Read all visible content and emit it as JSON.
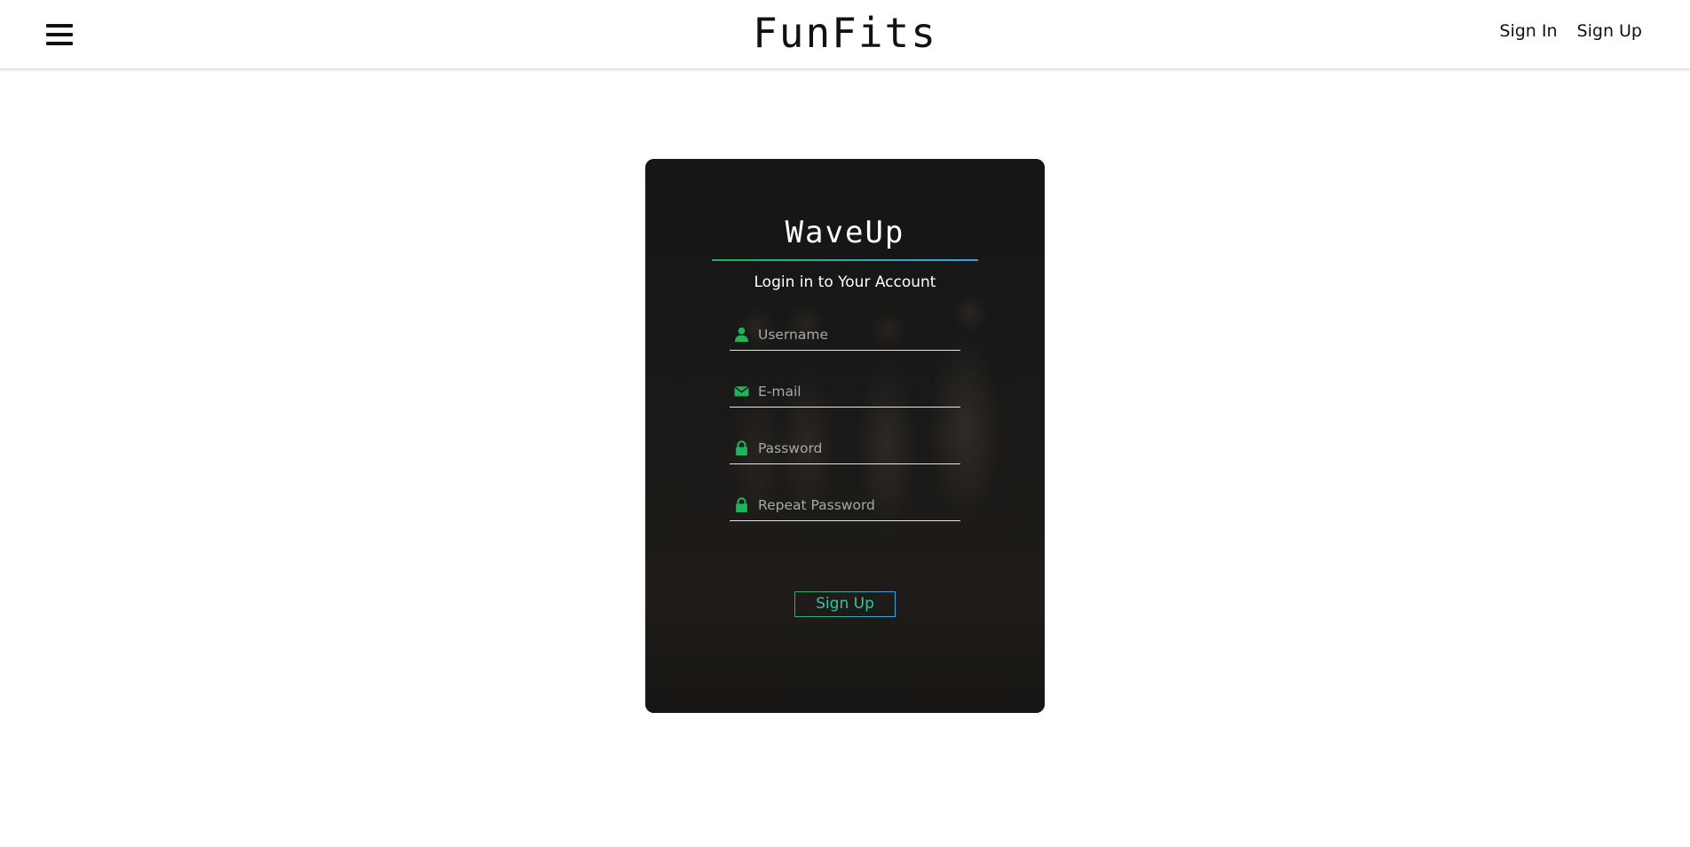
{
  "header": {
    "brand": "FunFits",
    "nav": {
      "sign_in": "Sign In",
      "sign_up": "Sign Up"
    },
    "menu_icon": "hamburger-icon"
  },
  "card": {
    "title": "WaveUp",
    "subtitle": "Login in to Your Account",
    "fields": {
      "username": {
        "placeholder": "Username",
        "value": "",
        "icon": "user-icon"
      },
      "email": {
        "placeholder": "E-mail",
        "value": "",
        "icon": "envelope-icon"
      },
      "password": {
        "placeholder": "Password",
        "value": "",
        "icon": "lock-icon"
      },
      "repeat_password": {
        "placeholder": "Repeat Password",
        "value": "",
        "icon": "lock-icon"
      }
    },
    "submit_label": "Sign Up"
  },
  "colors": {
    "accent_green": "#1fb35b",
    "accent_blue": "#3aa1e8",
    "card_background": "#161616"
  }
}
